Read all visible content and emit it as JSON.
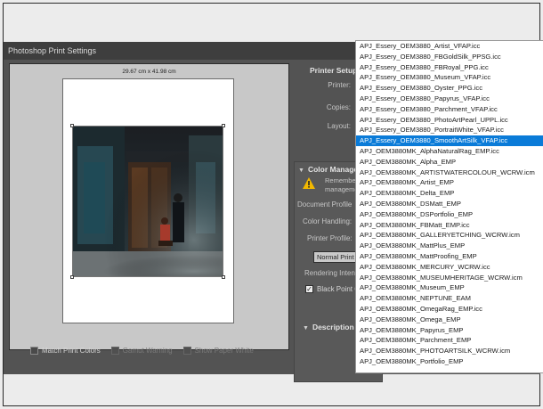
{
  "dialog": {
    "title": "Photoshop Print Settings",
    "paper_dimensions": "29.67 cm x 41.98 cm",
    "checkboxes": [
      {
        "label": "Match Print Colors",
        "checked": false,
        "enabled": true
      },
      {
        "label": "Gamut Warning",
        "checked": false,
        "enabled": false
      },
      {
        "label": "Show Paper White",
        "checked": false,
        "enabled": false
      }
    ]
  },
  "settings": {
    "printer_setup": {
      "heading": "Printer Setup",
      "printer_label": "Printer:",
      "copies_label": "Copies:",
      "layout_label": "Layout:"
    },
    "color_management": {
      "heading": "Color Manage",
      "warning_line1": "Remembe",
      "warning_line2": "manageme",
      "document_profile_label": "Document Profile",
      "color_handling_label": "Color Handling:",
      "printer_profile_label": "Printer Profile:",
      "rendering_value": "Normal Print",
      "rendering_intent_label": "Rendering Inten",
      "black_point_label": "Black Point C",
      "black_point_checked": true
    },
    "description": {
      "heading": "Description"
    }
  },
  "profile_dropdown": {
    "selected_index": 10,
    "items": [
      "APJ_Essery_OEM3880_Artist_VFAP.icc",
      "APJ_Essery_OEM3880_FBGoldSilk_PPSG.icc",
      "APJ_Essery_OEM3880_FBRoyal_PPG.icc",
      "APJ_Essery_OEM3880_Museum_VFAP.icc",
      "APJ_Essery_OEM3880_Oyster_PPG.icc",
      "APJ_Essery_OEM3880_Papyrus_VFAP.icc",
      "APJ_Essery_OEM3880_Parchment_VFAP.icc",
      "APJ_Essery_OEM3880_PhotoArtPearl_UPPL.icc",
      "APJ_Essery_OEM3880_PortraitWhite_VFAP.icc",
      "APJ_Essery_OEM3880_SmoothArtSilk_VFAP.icc",
      "APJ_OEM3880MK_AlphaNaturalRag_EMP.icc",
      "APJ_OEM3880MK_Alpha_EMP",
      "APJ_OEM3880MK_ARTISTWATERCOLOUR_WCRW.icm",
      "APJ_OEM3880MK_Artist_EMP",
      "APJ_OEM3880MK_Delta_EMP",
      "APJ_OEM3880MK_DSMatt_EMP",
      "APJ_OEM3880MK_DSPortfolio_EMP",
      "APJ_OEM3880MK_FBMatt_EMP.icc",
      "APJ_OEM3880MK_GALLERYETCHING_WCRW.icm",
      "APJ_OEM3880MK_MattPlus_EMP",
      "APJ_OEM3880MK_MattProofing_EMP",
      "APJ_OEM3880MK_MERCURY_WCRW.icc",
      "APJ_OEM3880MK_MUSEUMHERITAGE_WCRW.icm",
      "APJ_OEM3880MK_Museum_EMP",
      "APJ_OEM3880MK_NEPTUNE_EAM",
      "APJ_OEM3880MK_OmegaRag_EMP.icc",
      "APJ_OEM3880MK_Omega_EMP",
      "APJ_OEM3880MK_Papyrus_EMP",
      "APJ_OEM3880MK_Parchment_EMP",
      "APJ_OEM3880MK_PHOTOARTSILK_WCRW.icm",
      "APJ_OEM3880MK_Portfolio_EMP"
    ]
  },
  "colors": {
    "selection": "#0a7bd8",
    "dialog_bg": "#535353",
    "warning": "#f2b800"
  }
}
